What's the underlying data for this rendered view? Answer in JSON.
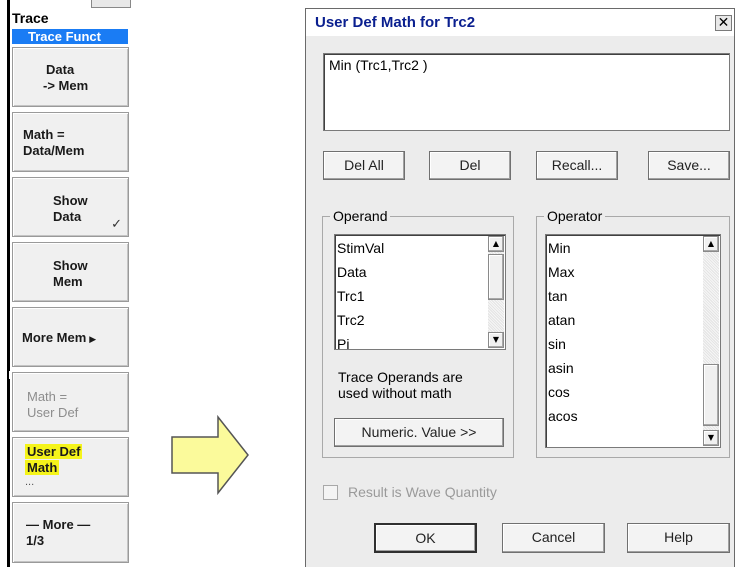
{
  "softkeys": {
    "title": "Trace",
    "subtitle": "Trace Funct",
    "data_to_mem": [
      "Data",
      "-> Mem"
    ],
    "math_data_mem": [
      "Math =",
      "Data/Mem"
    ],
    "show_data": [
      "Show",
      "Data"
    ],
    "show_data_check": "✓",
    "show_mem": [
      "Show",
      "Mem"
    ],
    "more_mem": "More Mem",
    "more_mem_arrow": "▶",
    "math_user_def": [
      "Math =",
      "User Def"
    ],
    "user_def_math": [
      "User Def",
      "Math",
      "..."
    ],
    "more": [
      "— More —",
      "1/3"
    ]
  },
  "dialog": {
    "title": "User Def Math for Trc2",
    "close_glyph": "✕",
    "expression": "Min (Trc1,Trc2 )",
    "buttons": {
      "del_all": "Del All",
      "del": "Del",
      "recall": "Recall...",
      "save": "Save..."
    },
    "operand": {
      "label": "Operand",
      "items": [
        "StimVal",
        "Data",
        "Trc1",
        "Trc2",
        "Pi"
      ],
      "note": [
        "Trace Operands are",
        "used without math"
      ],
      "numeric_button": "Numeric. Value >>"
    },
    "operator": {
      "label": "Operator",
      "items": [
        "Min",
        "Max",
        "tan",
        "atan",
        "sin",
        "asin",
        "cos",
        "acos"
      ]
    },
    "wave_quantity_label": "Result is Wave Quantity",
    "footer": {
      "ok": "OK",
      "cancel": "Cancel",
      "help": "Help"
    }
  },
  "colors": {
    "highlight": "#f5f41a",
    "subtitle_bg": "#1a7cf4",
    "title_text": "#0a1f8f",
    "arrow_fill": "#fbfa9b"
  }
}
